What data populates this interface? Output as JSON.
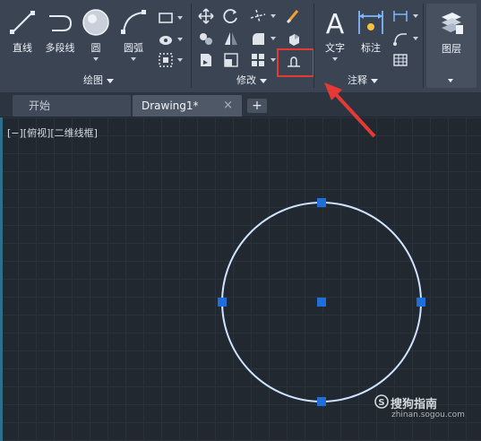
{
  "ribbon": {
    "draw_panel": {
      "title": "绘图",
      "line": "直线",
      "polyline": "多段线",
      "circle": "圆",
      "arc": "圆弧"
    },
    "modify_panel": {
      "title": "修改"
    },
    "annotate_panel": {
      "title": "注释",
      "text": "文字",
      "dimension": "标注"
    },
    "layers_panel": {
      "layers": "图层"
    }
  },
  "tabs": {
    "start": "开始",
    "drawing": "Drawing1*",
    "close_glyph": "×",
    "add_glyph": "+"
  },
  "viewport": {
    "view_label": "[−][俯视][二维线框]"
  },
  "watermark": {
    "brand": "搜狗指南",
    "url": "zhinan.sogou.com"
  },
  "colors": {
    "ribbon_bg": "#3b4453",
    "canvas_bg": "#212830",
    "grip": "#1e6fd9",
    "circle": "#cfe2ff",
    "highlight": "#e53935"
  }
}
